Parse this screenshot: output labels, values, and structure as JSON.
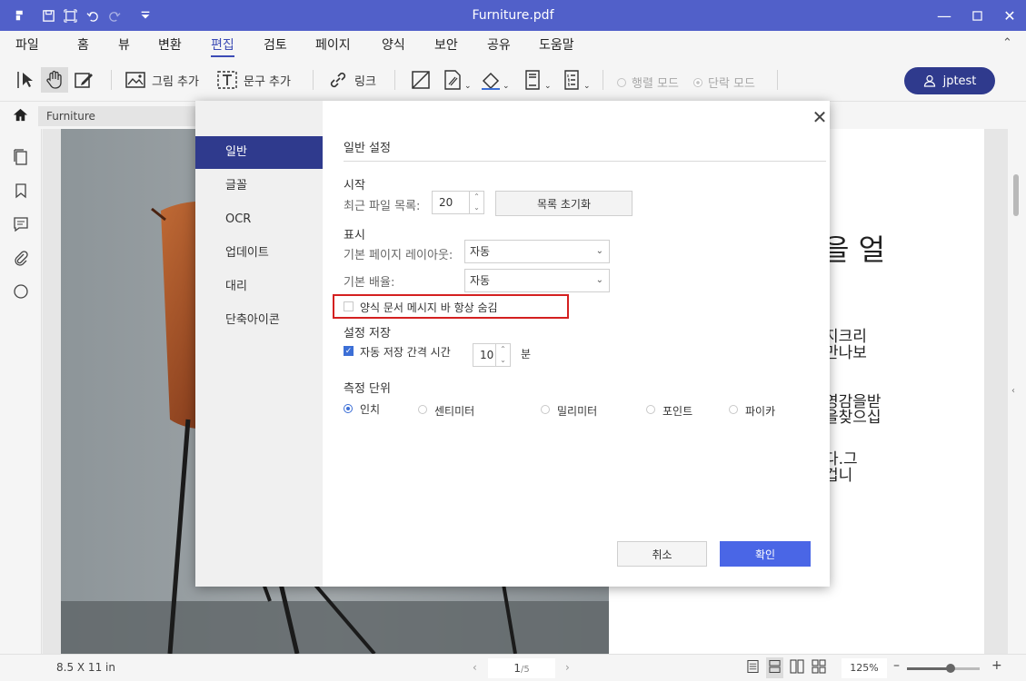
{
  "window": {
    "title": "Furniture.pdf"
  },
  "menu": [
    "파일",
    "홈",
    "뷰",
    "변환",
    "편집",
    "검토",
    "페이지",
    "양식",
    "보안",
    "공유",
    "도움말"
  ],
  "toolbar": {
    "add_image": "그림 추가",
    "add_text": "문구 추가",
    "link": "링크",
    "row_mode": "행렬 모드",
    "paragraph_mode": "단락 모드",
    "user": "jptest"
  },
  "breadcrumb": {
    "tab": "Furniture"
  },
  "document": {
    "text_lines": [
      "을 얼",
      "지크리",
      "만나보",
      "영감을받",
      "을찾으십",
      "다.그",
      "겁니"
    ]
  },
  "status": {
    "page_size": "8.5 X 11 in",
    "page_current": "1",
    "page_total": "/5",
    "zoom": "125%",
    "zoom_level_fraction": 0.6
  },
  "dialog": {
    "sidebar": [
      "일반",
      "글꼴",
      "OCR",
      "업데이트",
      "대리",
      "단축아이콘"
    ],
    "heading": "일반 설정",
    "start_section": "시작",
    "recent_files_label": "최근 파일 목록:",
    "recent_files_value": "20",
    "clear_list_button": "목록 초기화",
    "display_section": "표시",
    "page_layout_label": "기본 페이지 레이아웃:",
    "page_layout_value": "자동",
    "zoom_label": "기본 배율:",
    "zoom_value": "자동",
    "hide_form_bar_label": "양식 문서 메시지 바 항상 숨김",
    "save_section": "설정 저장",
    "autosave_label": "자동 저장 간격 시간",
    "autosave_value": "10",
    "autosave_unit": "분",
    "unit_section": "측정 단위",
    "units": [
      "인치",
      "센티미터",
      "밀리미터",
      "포인트",
      "파이카"
    ],
    "cancel": "취소",
    "ok": "확인"
  }
}
